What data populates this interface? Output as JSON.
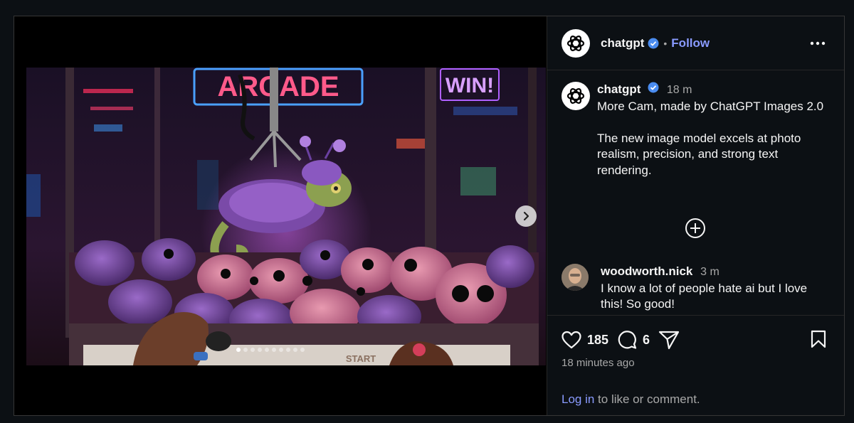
{
  "post": {
    "author": "chatgpt",
    "follow_label": "Follow",
    "separator": "•",
    "caption": {
      "author": "chatgpt",
      "time": "18 m",
      "text": "More Cam, made by ChatGPT Images 2.0\n\nThe new image model excels at photo realism, precision, and strong text rendering."
    },
    "image": {
      "sign_text": "ARCADE",
      "sign_win": "WIN!",
      "machine_label": "START",
      "carousel_count": 10,
      "carousel_active": 1
    },
    "comment": {
      "author": "woodworth.nick",
      "time": "3 m",
      "text": "I know a lot of people hate ai but I love this! So good!"
    },
    "likes": "185",
    "comments": "6",
    "time_ago": "18 minutes ago",
    "login_link": "Log in",
    "login_rest": " to like or comment."
  },
  "icons": {
    "avatar": "openai-logo-icon",
    "verified": "verified-badge-icon",
    "more": "more-horizontal-icon",
    "next": "chevron-right-icon",
    "add": "plus-circle-icon",
    "like": "heart-icon",
    "comment": "comment-bubble-icon",
    "share": "paper-plane-icon",
    "save": "bookmark-icon"
  },
  "colors": {
    "background": "#0c1014",
    "accent": "#8a9bff",
    "verified": "#4a8cf0",
    "muted": "#a8a8a8"
  }
}
